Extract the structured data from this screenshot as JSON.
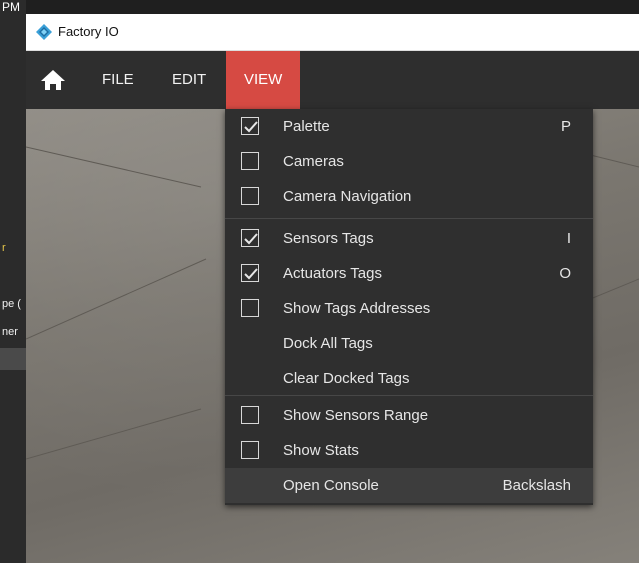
{
  "background_app": {
    "texts": [
      "PM",
      "r",
      "pe (",
      "ner"
    ]
  },
  "window": {
    "title": "Factory IO",
    "icon": "factory-io-logo-icon"
  },
  "menubar": {
    "home_icon": "home-icon",
    "file": "FILE",
    "edit": "EDIT",
    "view": "VIEW",
    "accent_color": "#d64a43"
  },
  "view_menu": {
    "items": [
      {
        "label": "Palette",
        "checked": true,
        "shortcut": "P"
      },
      {
        "label": "Cameras",
        "checked": false,
        "shortcut": ""
      },
      {
        "label": "Camera Navigation",
        "checked": false,
        "shortcut": ""
      },
      {
        "label": "Sensors Tags",
        "checked": true,
        "shortcut": "I"
      },
      {
        "label": "Actuators Tags",
        "checked": true,
        "shortcut": "O"
      },
      {
        "label": "Show Tags Addresses",
        "checked": false,
        "shortcut": ""
      },
      {
        "label": "Dock All Tags",
        "checked": null,
        "shortcut": ""
      },
      {
        "label": "Clear Docked Tags",
        "checked": null,
        "shortcut": ""
      },
      {
        "label": "Show Sensors Range",
        "checked": false,
        "shortcut": ""
      },
      {
        "label": "Show Stats",
        "checked": false,
        "shortcut": ""
      },
      {
        "label": "Open Console",
        "checked": null,
        "shortcut": "Backslash"
      }
    ]
  }
}
